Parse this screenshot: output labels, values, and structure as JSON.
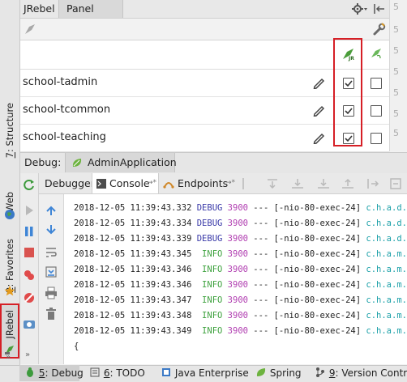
{
  "jrebel_panel": {
    "title": "JRebel",
    "tab": "Panel",
    "header_col_1_badge": "JR",
    "modules": [
      {
        "name": "school-tadmin",
        "jrebel_enabled": true,
        "remote_enabled": false
      },
      {
        "name": "school-tcommon",
        "jrebel_enabled": true,
        "remote_enabled": false
      },
      {
        "name": "school-teaching",
        "jrebel_enabled": true,
        "remote_enabled": false
      }
    ],
    "gutter_numbers": [
      "5",
      "5",
      "5",
      "5",
      "5",
      "5",
      "5"
    ]
  },
  "left_tool_tabs": {
    "structure": {
      "num": "7",
      "label": ": Structure"
    },
    "web": {
      "label": "Web"
    },
    "favorites": {
      "num": "2",
      "label": ": Favorites"
    },
    "jrebel": {
      "label": "JRebel"
    }
  },
  "debug": {
    "label": "Debug:",
    "session": "AdminApplication",
    "tabs": {
      "debugger": "Debugger",
      "console": "Console",
      "console_suffix": "→*",
      "endpoints": "Endpoints",
      "endpoints_suffix": "→*"
    },
    "log_lines": [
      {
        "ts": "2018-12-05 11:39:43.332",
        "level": "DEBUG",
        "pid": "3900",
        "thread": "--- [-nio-80-exec-24]",
        "logger": "c.h.a.d.Teac"
      },
      {
        "ts": "2018-12-05 11:39:43.334",
        "level": "DEBUG",
        "pid": "3900",
        "thread": "--- [-nio-80-exec-24]",
        "logger": "c.h.a.d.Teac"
      },
      {
        "ts": "2018-12-05 11:39:43.339",
        "level": "DEBUG",
        "pid": "3900",
        "thread": "--- [-nio-80-exec-24]",
        "logger": "c.h.a.d.Teac"
      },
      {
        "ts": "2018-12-05 11:39:43.345",
        "level": " INFO",
        "pid": "3900",
        "thread": "--- [-nio-80-exec-24]",
        "logger": "c.h.a.m.inte"
      },
      {
        "ts": "2018-12-05 11:39:43.346",
        "level": " INFO",
        "pid": "3900",
        "thread": "--- [-nio-80-exec-24]",
        "logger": "c.h.a.m.inte"
      },
      {
        "ts": "2018-12-05 11:39:43.346",
        "level": " INFO",
        "pid": "3900",
        "thread": "--- [-nio-80-exec-24]",
        "logger": "c.h.a.m.inte"
      },
      {
        "ts": "2018-12-05 11:39:43.347",
        "level": " INFO",
        "pid": "3900",
        "thread": "--- [-nio-80-exec-24]",
        "logger": "c.h.a.m.inte"
      },
      {
        "ts": "2018-12-05 11:39:43.348",
        "level": " INFO",
        "pid": "3900",
        "thread": "--- [-nio-80-exec-24]",
        "logger": "c.h.a.m.inte"
      },
      {
        "ts": "2018-12-05 11:39:43.349",
        "level": " INFO",
        "pid": "3900",
        "thread": "--- [-nio-80-exec-24]",
        "logger": "c.h.a.m.inte"
      }
    ],
    "brace_line": "{"
  },
  "status_bar": {
    "debug": {
      "num": "5",
      "label": ": Debug"
    },
    "todo": {
      "num": "6",
      "label": ": TODO"
    },
    "java_enterprise": {
      "label": "Java Enterprise"
    },
    "spring": {
      "label": "Spring"
    },
    "version_control": {
      "num": "9",
      "label": ": Version Control"
    }
  },
  "colors": {
    "highlight_red": "#d61f26",
    "jrebel_green": "#4a9d3a",
    "debug_level": "#3a3aa8",
    "info_level": "#3fa23f",
    "pid": "#b03cb0",
    "logger": "#1aa0a8"
  }
}
